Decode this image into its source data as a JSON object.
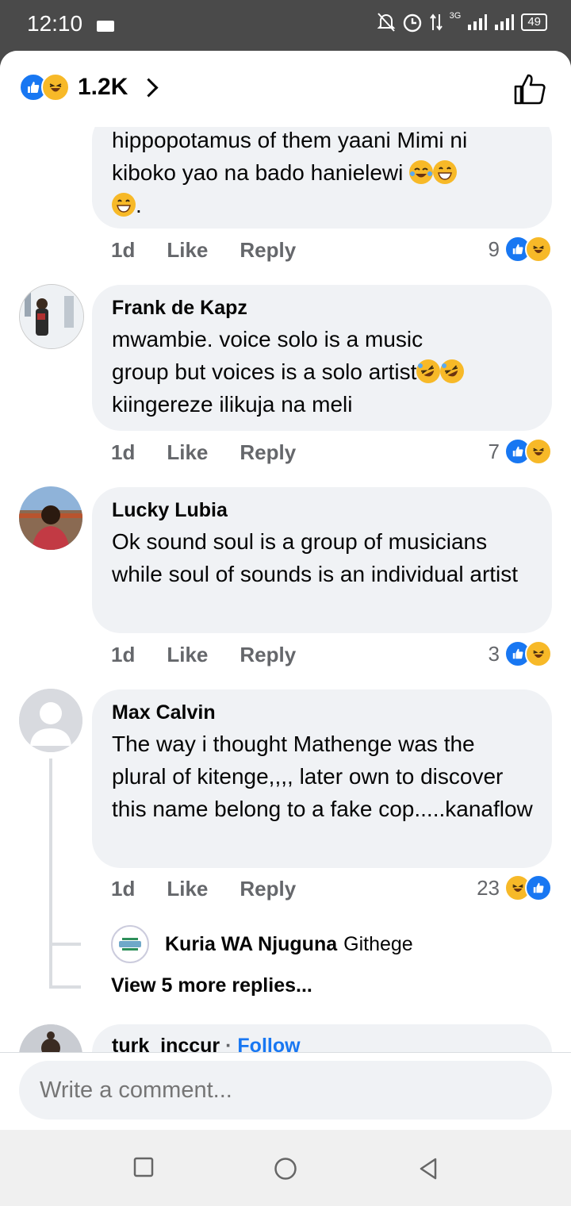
{
  "status_bar": {
    "time": "12:10",
    "network": "3G",
    "battery": "49"
  },
  "header": {
    "reaction_count": "1.2K",
    "icons": [
      "like-icon",
      "haha-icon",
      "chevron-right-icon",
      "thumbs-up-outline-icon"
    ]
  },
  "comments": [
    {
      "text_line1": "hippopotamus of them yaani Mimi ni",
      "text_line2": "kiboko yao na bado hanielewi",
      "text_line3": ".",
      "time": "1d",
      "like": "Like",
      "reply": "Reply",
      "reactions": "9"
    },
    {
      "author": "Frank de Kapz",
      "text_line1": "mwambie. voice solo is a music",
      "text_line2": "group but voices is a solo artist",
      "text_line3": "kiingereze ilikuja na meli",
      "time": "1d",
      "like": "Like",
      "reply": "Reply",
      "reactions": "7"
    },
    {
      "author": "Lucky Lubia",
      "text": "Ok sound soul is a group of musicians while soul of sounds is an individual artist",
      "time": "1d",
      "like": "Like",
      "reply": "Reply",
      "reactions": "3"
    },
    {
      "author": "Max Calvin",
      "text": "The way i thought Mathenge was the plural of kitenge,,,, later own to discover this name belong to a fake cop.....kanaflow",
      "time": "1d",
      "like": "Like",
      "reply": "Reply",
      "reactions": "23"
    },
    {
      "author": "turk_inccur",
      "follow": "Follow"
    }
  ],
  "replies_preview": {
    "author": "Kuria WA Njuguna",
    "text": "Githege",
    "more": "View 5 more replies..."
  },
  "composer": {
    "placeholder": "Write a comment..."
  },
  "colors": {
    "like_blue": "#1877f2",
    "haha_yellow": "#f7b928",
    "bubble": "#f0f2f5",
    "meta_gray": "#65676b"
  }
}
